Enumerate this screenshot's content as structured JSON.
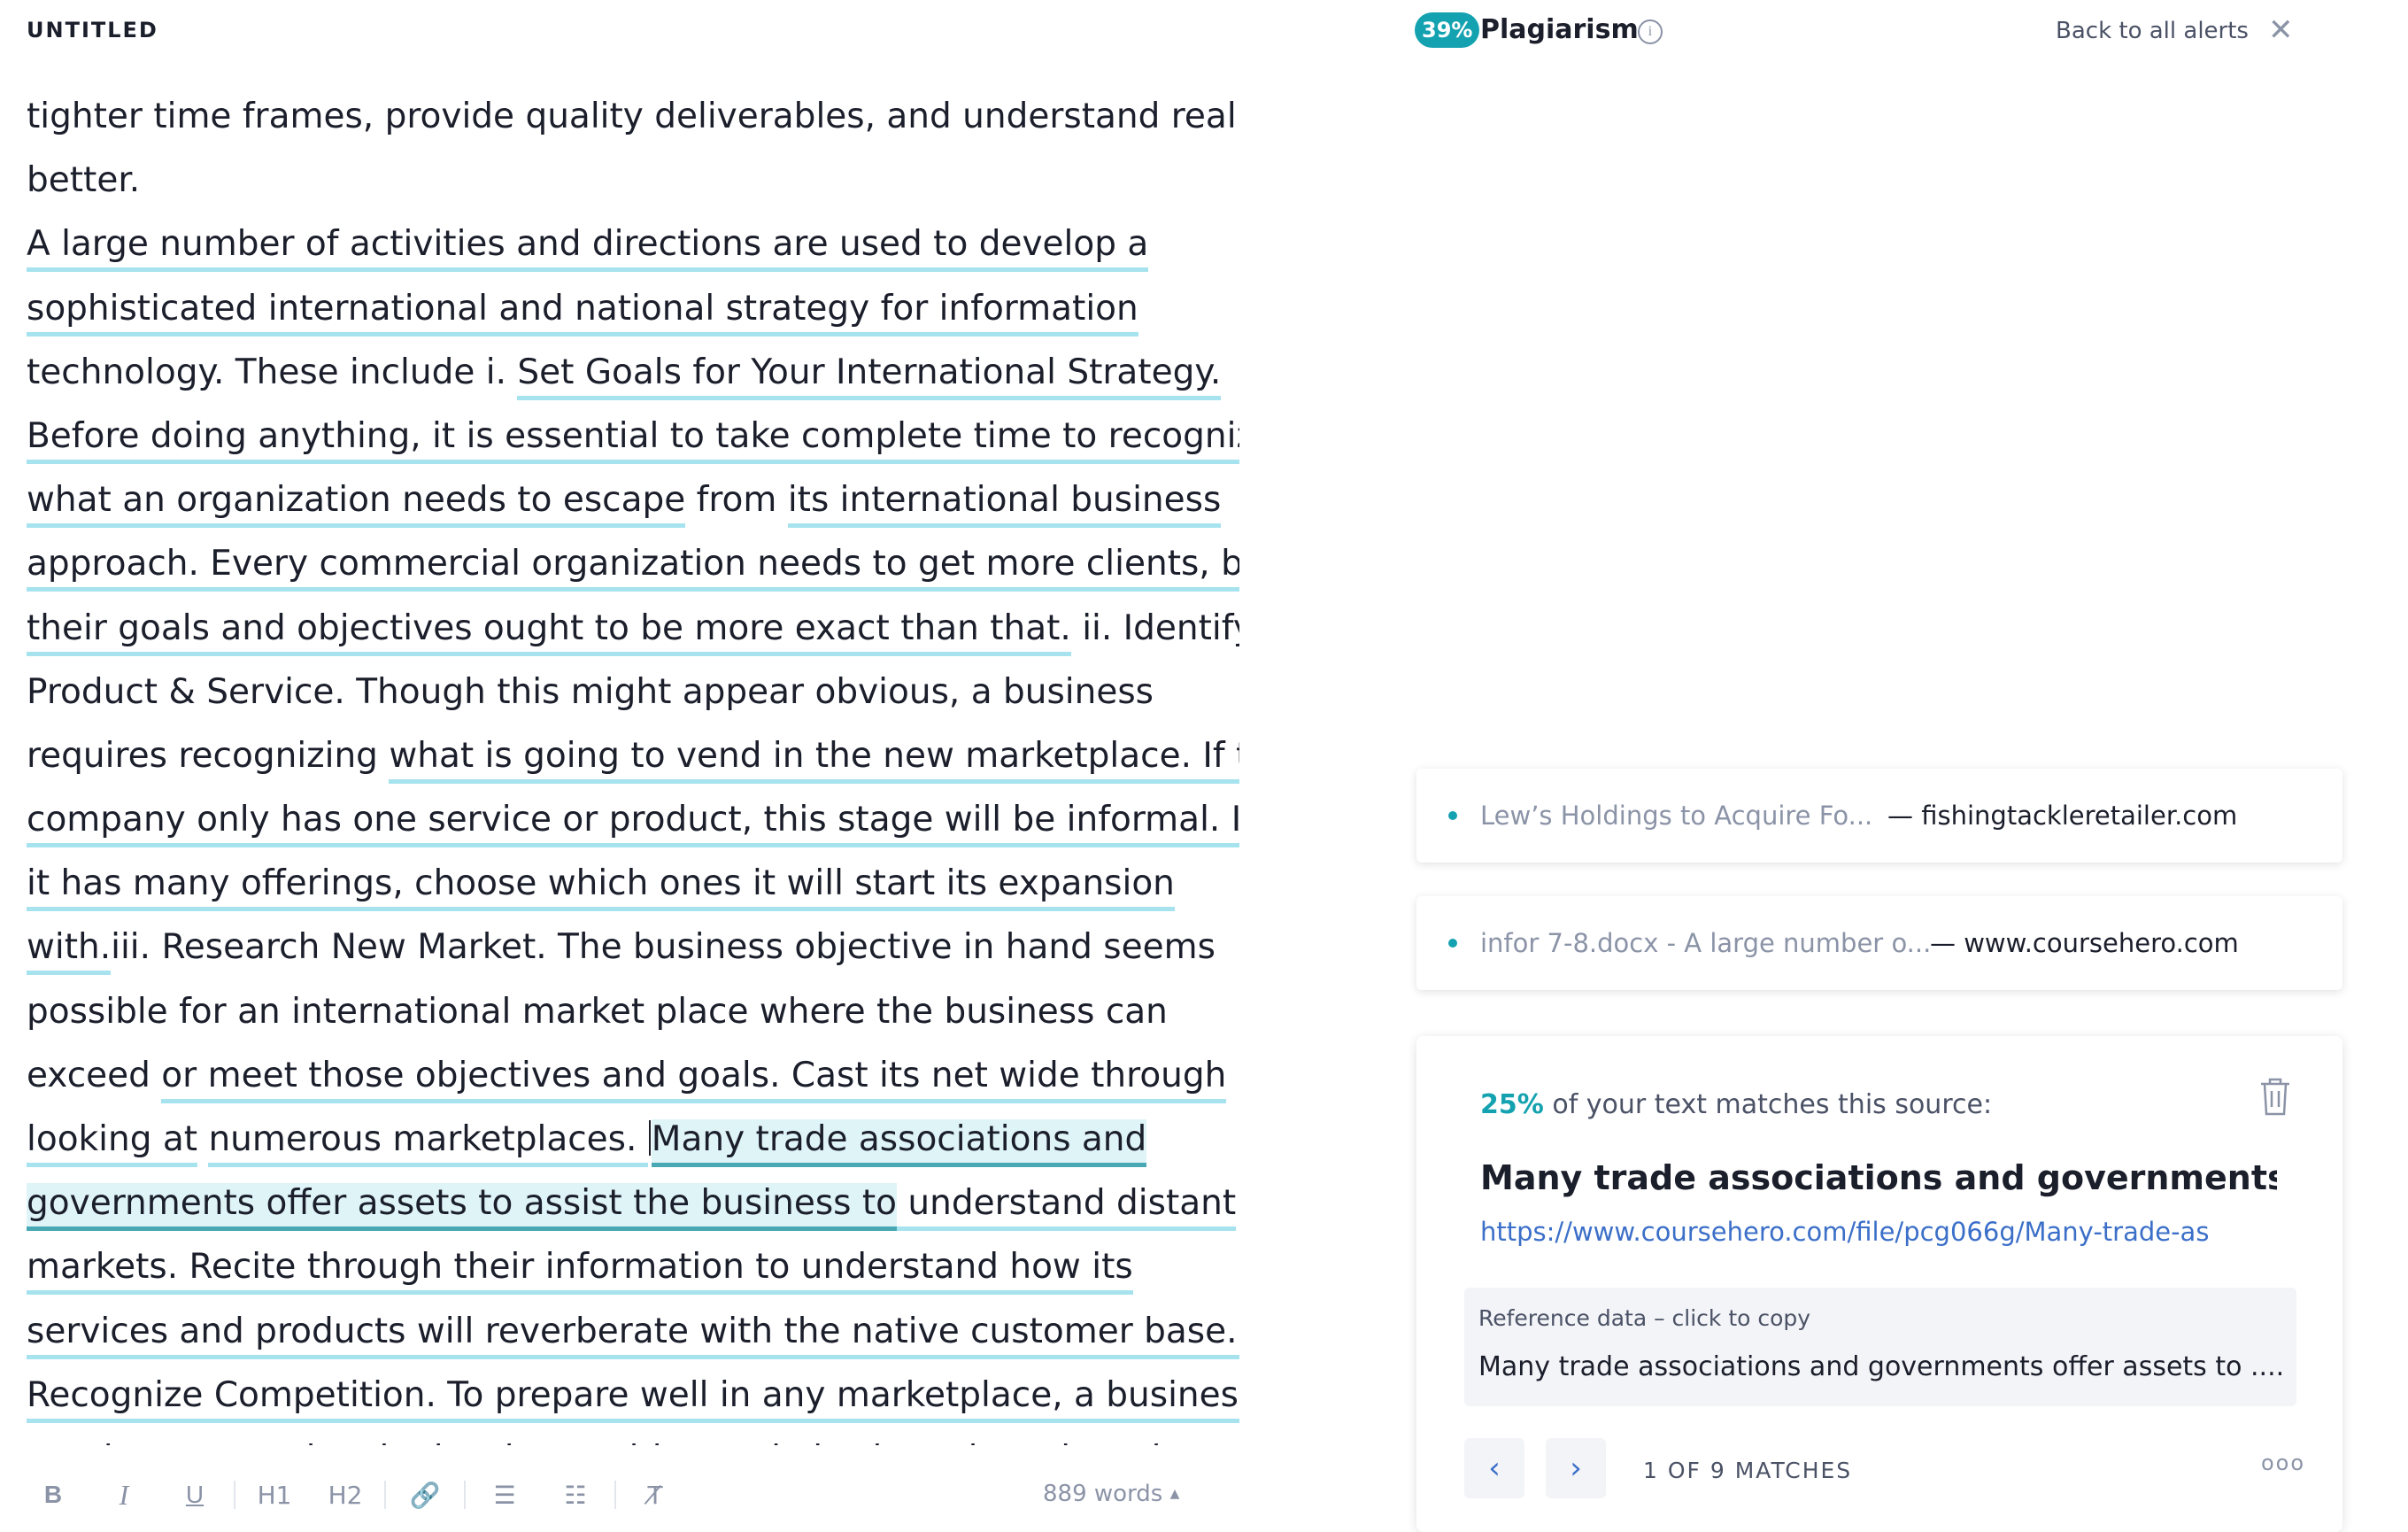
{
  "document": {
    "title": "UNTITLED",
    "lines": [
      [
        {
          "t": "tighter time frames, provide quality deliverables, and understand reality"
        }
      ],
      [
        {
          "t": "better."
        }
      ],
      [
        {
          "t": "A large number of activities and directions are used to develop a",
          "s": "u"
        }
      ],
      [
        {
          "t": "sophisticated international and national strategy for information",
          "s": "u"
        }
      ],
      [
        {
          "t": "technology. These include i. "
        },
        {
          "t": "Set Goals for Your International Strategy.",
          "s": "u"
        }
      ],
      [
        {
          "t": "Before doing anything, it is essential to take complete time to recognize",
          "s": "u"
        }
      ],
      [
        {
          "t": "what an organization needs to escape",
          "s": "u"
        },
        {
          "t": " from "
        },
        {
          "t": "its international business",
          "s": "u"
        }
      ],
      [
        {
          "t": "approach. Every commercial organization needs to get more clients, but",
          "s": "u"
        }
      ],
      [
        {
          "t": "their goals and objectives ought to be more exact than that.",
          "s": "u"
        },
        {
          "t": " ii. Identify"
        }
      ],
      [
        {
          "t": "Product & Service. Though this might appear obvious, a business"
        }
      ],
      [
        {
          "t": "requires recognizing "
        },
        {
          "t": "what is going to vend in the new marketplace. If the",
          "s": "u"
        }
      ],
      [
        {
          "t": "company only has one service or product, this stage will be informal. If",
          "s": "u"
        }
      ],
      [
        {
          "t": "it has many offerings, choose which ones it will start its expansion",
          "s": "u"
        }
      ],
      [
        {
          "t": "with.",
          "s": "u"
        },
        {
          "t": "iii. Research New Market. The business objective in hand seems"
        }
      ],
      [
        {
          "t": "possible for an international market place where the business can"
        }
      ],
      [
        {
          "t": "exceed "
        },
        {
          "t": "or meet those objectives and goals. Cast its net wide through",
          "s": "u"
        }
      ],
      [
        {
          "t": "looking at",
          "s": "u"
        },
        {
          "t": " "
        },
        {
          "t": "numerous marketplaces. ",
          "s": "u"
        },
        {
          "t": "",
          "s": "caret"
        },
        {
          "t": "Many trade associations and",
          "s": "hl"
        }
      ],
      [
        {
          "t": "governments offer assets to assist the business to",
          "s": "hl"
        },
        {
          "t": " understand distant",
          "s": "u"
        }
      ],
      [
        {
          "t": "markets. Recite through their information to understand how its",
          "s": "u"
        }
      ],
      [
        {
          "t": "services and products will reverberate with the native customer base.iv.",
          "s": "u"
        }
      ],
      [
        {
          "t": "Recognize Competition. To prepare well in any marketplace, a business",
          "s": "u"
        }
      ],
      [
        {
          "t": "needs to recognize the local opposition and also how they slant the"
        }
      ]
    ]
  },
  "toolbar": {
    "items": [
      {
        "name": "bold-button",
        "label": "B",
        "cls": "bold"
      },
      {
        "name": "italic-button",
        "label": "I",
        "cls": "ital"
      },
      {
        "name": "underline-button",
        "label": "U",
        "cls": "und"
      },
      {
        "sep": true
      },
      {
        "name": "heading1-button",
        "label": "H1",
        "cls": ""
      },
      {
        "name": "heading2-button",
        "label": "H2",
        "cls": ""
      },
      {
        "sep": true
      },
      {
        "name": "link-icon",
        "label": "🔗",
        "cls": ""
      },
      {
        "sep": true
      },
      {
        "name": "ordered-list-icon",
        "label": "☰",
        "cls": ""
      },
      {
        "name": "bullet-list-icon",
        "label": "☷",
        "cls": ""
      },
      {
        "sep": true
      },
      {
        "name": "clear-format-icon",
        "label": "T̸",
        "cls": ""
      }
    ],
    "word_count": "889 words",
    "word_count_arrow": "▲"
  },
  "panel": {
    "badge": "39%",
    "title": "Plagiarism",
    "info_icon": "i",
    "back_label": "Back to all alerts",
    "close_icon": "✕",
    "sources": [
      {
        "name": "Lew’s Holdings to Acquire Fo...",
        "domain": "fishingtackleretailer.com"
      },
      {
        "name": "infor 7-8.docx - A large number o...",
        "domain": "www.coursehero.com"
      }
    ],
    "source_separator": "—",
    "detail": {
      "percent": "25%",
      "percent_text": " of your text matches this source:",
      "heading": "Many trade associations and governments of",
      "url": "https://www.coursehero.com/file/pcg066g/Many-trade-as",
      "ref_label": "Reference data – click to copy",
      "ref_text": "Many trade associations and governments offer assets to .... ...",
      "prev_icon": "‹",
      "next_icon": "›",
      "count": "1 OF 9 MATCHES",
      "more": "ooo"
    }
  }
}
